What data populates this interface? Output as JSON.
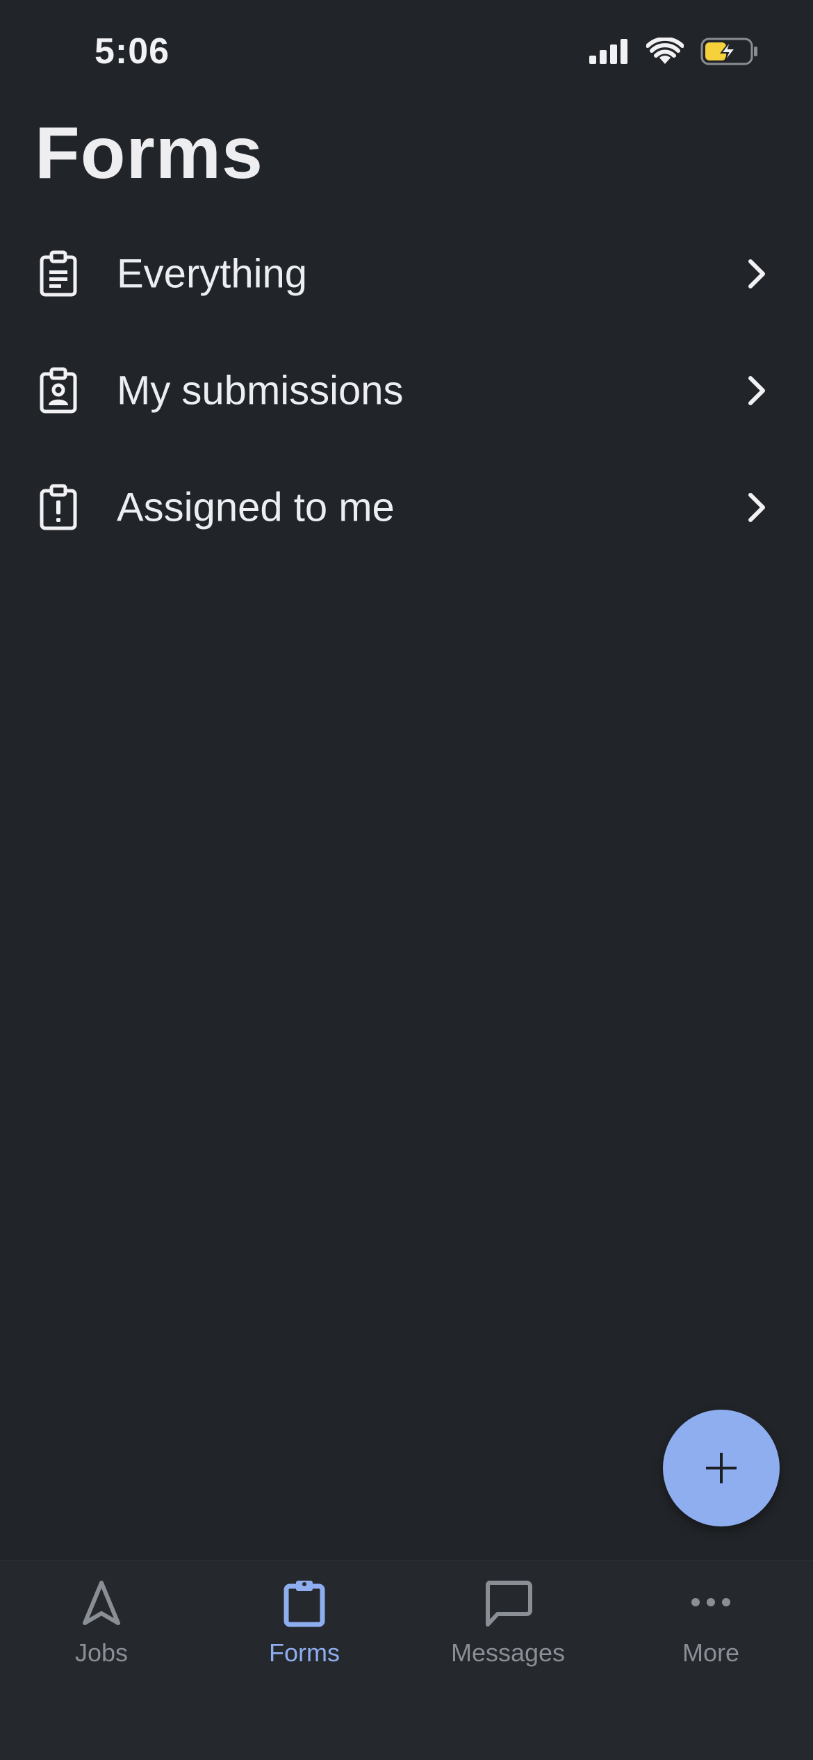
{
  "status_bar": {
    "time": "5:06",
    "signal_icon": "cellular-signal-icon",
    "wifi_icon": "wifi-icon",
    "battery_icon": "battery-charging-icon",
    "battery_color": "#f5d23c"
  },
  "header": {
    "title": "Forms"
  },
  "list": {
    "items": [
      {
        "label": "Everything",
        "icon": "clipboard-list-icon"
      },
      {
        "label": "My submissions",
        "icon": "clipboard-user-icon"
      },
      {
        "label": "Assigned to me",
        "icon": "clipboard-alert-icon"
      }
    ]
  },
  "fab": {
    "icon": "plus-icon",
    "color": "#8eaef0"
  },
  "tab_bar": {
    "tabs": [
      {
        "label": "Jobs",
        "icon": "navigation-arrow-icon",
        "active": false
      },
      {
        "label": "Forms",
        "icon": "clipboard-icon",
        "active": true
      },
      {
        "label": "Messages",
        "icon": "message-bubble-icon",
        "active": false
      },
      {
        "label": "More",
        "icon": "more-dots-icon",
        "active": false
      }
    ],
    "active_color": "#8eaef0",
    "inactive_color": "#8a8e95"
  }
}
